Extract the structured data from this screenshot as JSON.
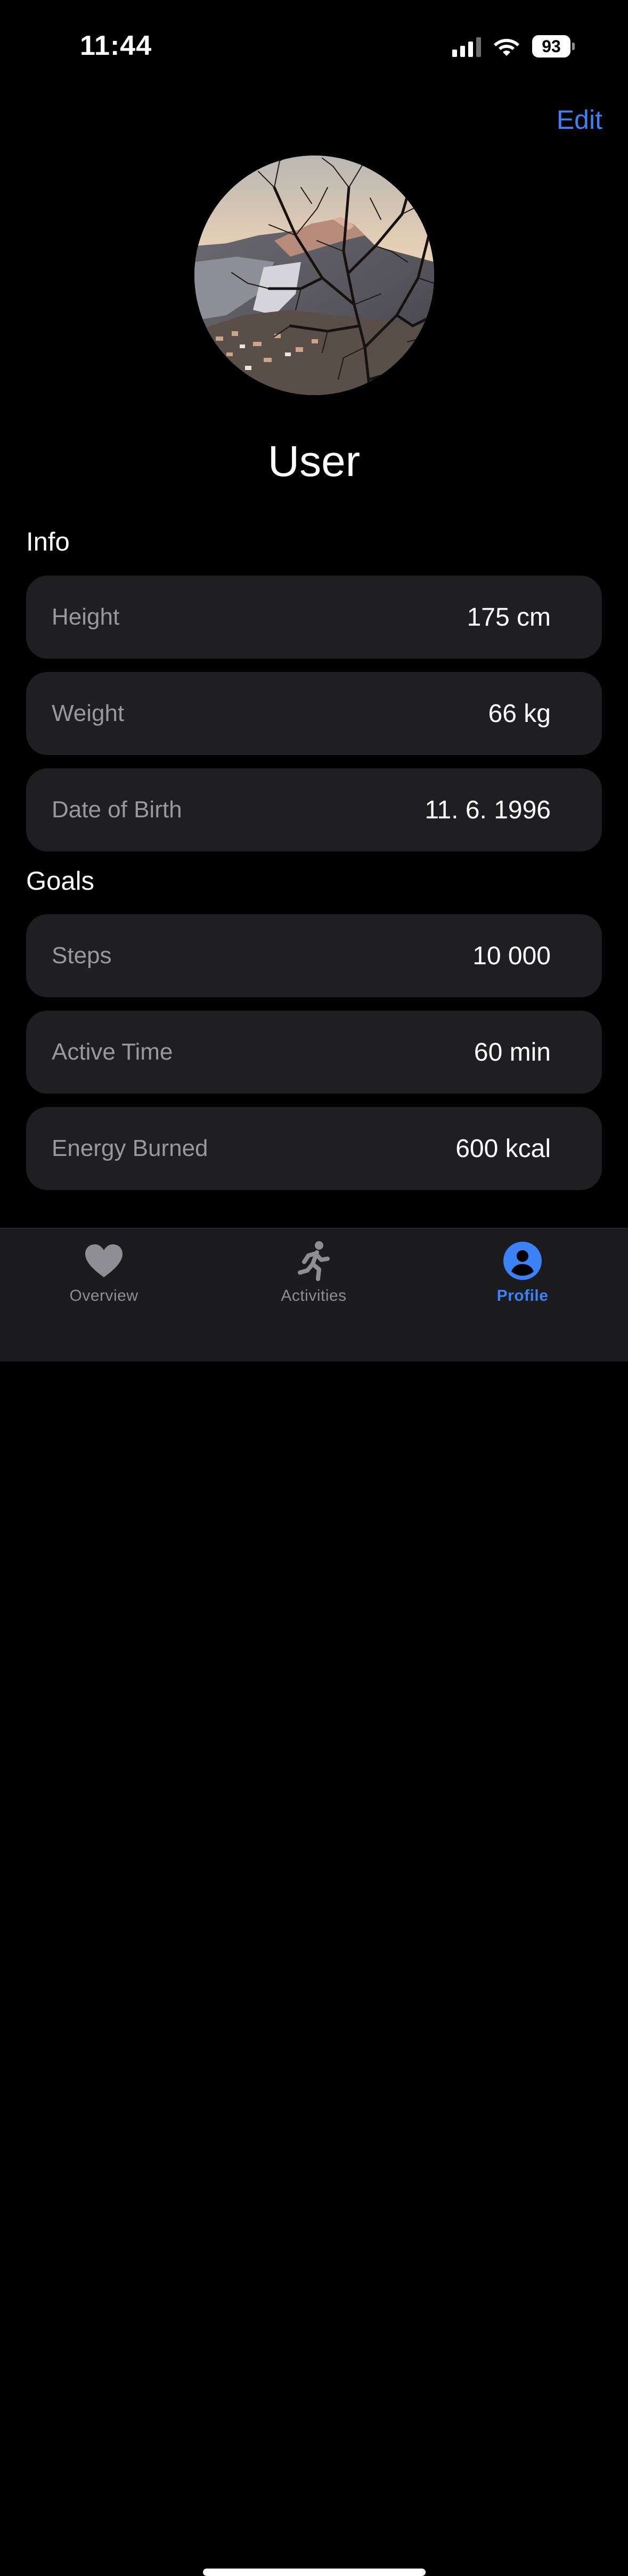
{
  "status_bar": {
    "time": "11:44",
    "battery": "93",
    "icons": [
      "signal-icon",
      "wifi-icon",
      "battery-icon"
    ]
  },
  "header": {
    "edit_label": "Edit"
  },
  "profile": {
    "name": "User",
    "avatar": "mountain-photo"
  },
  "info": {
    "title": "Info",
    "rows": [
      {
        "label": "Height",
        "value": "175 cm"
      },
      {
        "label": "Weight",
        "value": "66 kg"
      },
      {
        "label": "Date of Birth",
        "value": "11. 6. 1996"
      }
    ]
  },
  "goals": {
    "title": "Goals",
    "rows": [
      {
        "label": "Steps",
        "value": "10 000"
      },
      {
        "label": "Active Time",
        "value": "60 min"
      },
      {
        "label": "Energy Burned",
        "value": "600 kcal"
      }
    ]
  },
  "tab_bar": {
    "tabs": [
      {
        "label": "Overview",
        "icon": "heart-icon"
      },
      {
        "label": "Activities",
        "icon": "running-figure-icon"
      },
      {
        "label": "Profile",
        "icon": "person-circle-icon"
      }
    ],
    "active": "Profile"
  },
  "colors": {
    "accent": "#3b82f6",
    "background": "#000000",
    "card": "#1f1f21",
    "tab_bar": "#1c1c1e",
    "inactive": "#8e8e93"
  }
}
